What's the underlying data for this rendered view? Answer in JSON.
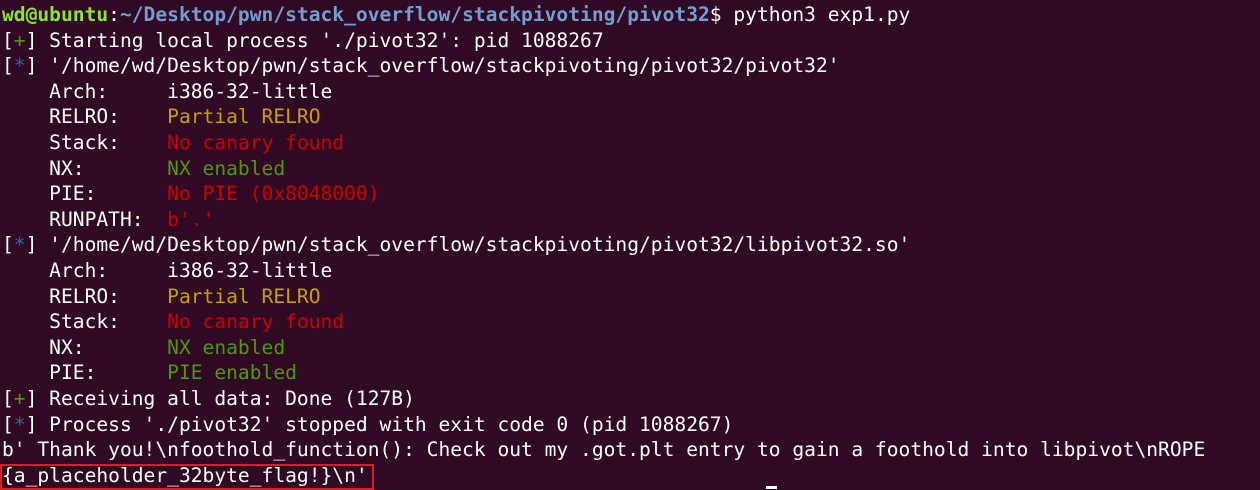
{
  "prompt": {
    "user": "wd@ubuntu",
    "path": "~/Desktop/pwn/stack_overflow/stackpivoting/pivot32",
    "symbol": "$",
    "command": " python3 exp1.py"
  },
  "lines": [
    {
      "mark": "+",
      "text": " Starting local process './pivot32': pid 1088267"
    },
    {
      "mark": "*",
      "text": " '/home/wd/Desktop/pwn/stack_overflow/stackpivoting/pivot32/pivot32'"
    }
  ],
  "binary1": {
    "arch_label": "    Arch:     ",
    "arch_value": "i386-32-little",
    "relro_label": "    RELRO:    ",
    "relro_value": "Partial RELRO",
    "stack_label": "    Stack:    ",
    "stack_value": "No canary found",
    "nx_label": "    NX:       ",
    "nx_value": "NX enabled",
    "pie_label": "    PIE:      ",
    "pie_value": "No PIE (0x8048000)",
    "runpath_label": "    RUNPATH:  ",
    "runpath_value": "b'.'"
  },
  "lib_header": {
    "mark": "*",
    "text": " '/home/wd/Desktop/pwn/stack_overflow/stackpivoting/pivot32/libpivot32.so'"
  },
  "binary2": {
    "arch_label": "    Arch:     ",
    "arch_value": "i386-32-little",
    "relro_label": "    RELRO:    ",
    "relro_value": "Partial RELRO",
    "stack_label": "    Stack:    ",
    "stack_value": "No canary found",
    "nx_label": "    NX:       ",
    "nx_value": "NX enabled",
    "pie_label": "    PIE:      ",
    "pie_value": "PIE enabled"
  },
  "tail": [
    {
      "mark": "+",
      "text": " Receiving all data: Done (127B)"
    },
    {
      "mark": "*",
      "text": " Process './pivot32' stopped with exit code 0 (pid 1088267)"
    }
  ],
  "output_line": "b' Thank you!\\nfoothold_function(): Check out my .got.plt entry to gain a foothold into libpivot\\nROPE",
  "flag_line": "{a_placeholder_32byte_flag!}\\n'",
  "colors": {
    "background": "#300a24",
    "user": "#8ae234",
    "path": "#729fcf",
    "warn_yellow": "#c4a000",
    "bad_red": "#cc0000",
    "good_green": "#4e9a06",
    "highlight_box": "#e01b24"
  }
}
